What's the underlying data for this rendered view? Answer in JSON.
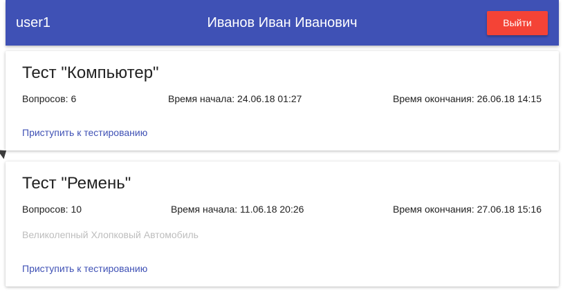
{
  "header": {
    "username": "user1",
    "full_name": "Иванов Иван Иванович",
    "logout_label": "Выйти",
    "background_color": "#3f51b5",
    "logout_color": "#f44336"
  },
  "tests": [
    {
      "title": "Тест \"Компьютер\"",
      "questions": "Вопросов: 6",
      "start_time": "Время начала: 24.06.18 01:27",
      "end_time": "Время окончания: 26.06.18 14:15",
      "action_label": "Приступить к тестированию"
    },
    {
      "title": "Тест \"Ремень\"",
      "questions": "Вопросов: 10",
      "start_time": "Время начала: 11.06.18 20:26",
      "end_time": "Время окончания: 27.06.18 15:16",
      "description": "Великолепный Хлопковый Автомобиль",
      "action_label": "Приступить к тестированию"
    }
  ],
  "accent_link_color": "#3f51b5"
}
